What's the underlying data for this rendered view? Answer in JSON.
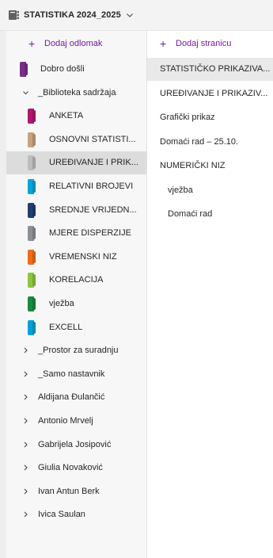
{
  "notebook": {
    "title": "STATISTIKA 2024_2025",
    "icon": "notebook-icon"
  },
  "sections_pane": {
    "add_label": "Dodaj odlomak",
    "items": [
      {
        "label": "Dobro došli",
        "color": "#7b2d8b",
        "kind": "section"
      },
      {
        "label": "_Biblioteka sadržaja",
        "kind": "group-expanded"
      },
      {
        "label": "ANKETA",
        "color": "#b0166b",
        "kind": "child"
      },
      {
        "label": "OSNOVNI STATISTI...",
        "color": "#c8a17b",
        "kind": "child"
      },
      {
        "label": "UREĐIVANJE I PRIK...",
        "color": "#bdbdbd",
        "kind": "child",
        "selected": true
      },
      {
        "label": "RELATIVNI BROJEVI",
        "color": "#00a4d9",
        "kind": "child"
      },
      {
        "label": "SREDNJE VRIJEDN...",
        "color": "#1f3f72",
        "kind": "child"
      },
      {
        "label": "MJERE DISPERZIJE",
        "color": "#8c9094",
        "kind": "child"
      },
      {
        "label": "VREMENSKI NIZ",
        "color": "#ee6b1c",
        "kind": "child"
      },
      {
        "label": "KORELACIJA",
        "color": "#8cc63e",
        "kind": "child"
      },
      {
        "label": "vježba",
        "color": "#168c3c",
        "kind": "child"
      },
      {
        "label": "EXCELL",
        "color": "#00a1d6",
        "kind": "child"
      },
      {
        "label": "_Prostor za suradnju",
        "kind": "group"
      },
      {
        "label": "_Samo nastavnik",
        "kind": "group"
      },
      {
        "label": "Aldijana Đulančić",
        "kind": "group"
      },
      {
        "label": "Antonio Mrvelj",
        "kind": "group"
      },
      {
        "label": "Gabrijela Josipović",
        "kind": "group"
      },
      {
        "label": "Giulia Novaković",
        "kind": "group"
      },
      {
        "label": "Ivan Antun Berk",
        "kind": "group"
      },
      {
        "label": "Ivica Saulan",
        "kind": "group"
      }
    ]
  },
  "pages_pane": {
    "add_label": "Dodaj stranicu",
    "items": [
      {
        "label": "STATISTIČKO PRIKAZIVA...",
        "level": 0,
        "selected": true
      },
      {
        "label": "UREĐIVANJE I PRIKAZIV...",
        "level": 0
      },
      {
        "label": "Grafički prikaz",
        "level": 0
      },
      {
        "label": "Domaći rad – 25.10.",
        "level": 0
      },
      {
        "label": "NUMERIČKI NIZ",
        "level": 0
      },
      {
        "label": "vježba",
        "level": 1
      },
      {
        "label": "Domaći rad",
        "level": 1
      }
    ]
  },
  "accent_color": "#7719aa"
}
